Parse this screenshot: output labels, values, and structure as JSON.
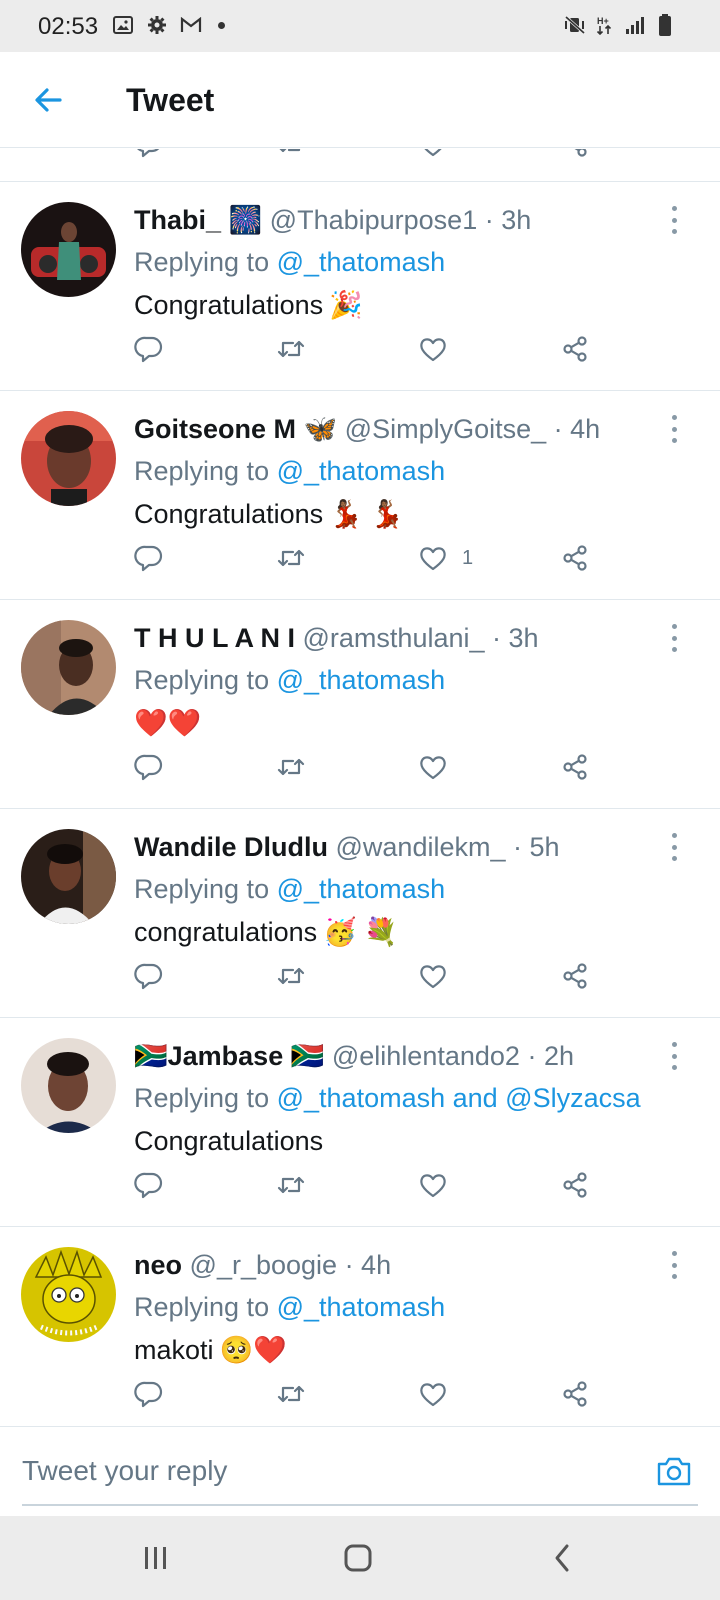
{
  "status_bar": {
    "time": "02:53",
    "left_icons": [
      "gallery-icon",
      "settings-icon",
      "gmail-icon",
      "notification-dot-icon"
    ],
    "right_icons": [
      "vibrate-mute-icon",
      "data-arrows-icon",
      "signal-icon",
      "battery-icon"
    ]
  },
  "header": {
    "title": "Tweet",
    "back_icon": "arrow-left-icon"
  },
  "reply_prefix": "Replying to",
  "replies": [
    {
      "name": "Thabi_",
      "name_emoji": "🎆",
      "handle": "@Thabipurpose1",
      "time": "· 3h",
      "replying_to": "@_thatomash",
      "text": "Congratulations",
      "text_emoji": "🎉",
      "like_count": "",
      "avatar_color": "#5a3a38"
    },
    {
      "name": "Goitseone M",
      "name_emoji": "🦋",
      "handle": "@SimplyGoitse_",
      "time": "· 4h",
      "replying_to": "@_thatomash",
      "text": "Congratulations",
      "text_emoji": "💃🏾 💃🏾",
      "like_count": "1",
      "avatar_color": "#b5473a"
    },
    {
      "name": "T H U L A N I",
      "name_emoji": "",
      "handle": "@ramsthulani_",
      "time": "· 3h",
      "replying_to": "@_thatomash",
      "text": "",
      "text_emoji": "❤️❤️",
      "like_count": "",
      "avatar_color": "#8a6a56"
    },
    {
      "name": "Wandile Dludlu",
      "name_emoji": "",
      "handle": "@wandilekm_",
      "time": "· 5h",
      "replying_to": "@_thatomash",
      "text": "congratulations",
      "text_emoji": "🥳 💐",
      "like_count": "",
      "avatar_color": "#3b2b24"
    },
    {
      "name": "Jambase",
      "name_prefix_emoji": "🇿🇦",
      "name_emoji": "🇿🇦",
      "handle": "@elihlentando2",
      "time": "· 2h",
      "replying_to": "@_thatomash and @Slyzacsa",
      "text": "Congratulations",
      "text_emoji": "",
      "like_count": "",
      "avatar_color": "#d8cfc8"
    },
    {
      "name": "neo",
      "name_emoji": "",
      "handle": "@_r_boogie",
      "time": "· 4h",
      "replying_to": "@_thatomash",
      "text": "makoti",
      "text_emoji": "🥺❤️",
      "like_count": "",
      "avatar_color": "#d6c400"
    }
  ],
  "action_icons": [
    "reply-icon",
    "retweet-icon",
    "like-icon",
    "share-icon"
  ],
  "compose": {
    "placeholder": "Tweet your reply",
    "value": "",
    "camera_icon": "camera-icon"
  },
  "nav_bar": {
    "icons": [
      "recents-icon",
      "home-icon",
      "back-icon"
    ]
  },
  "colors": {
    "accent": "#1b95e0",
    "secondary_text": "#657786",
    "divider": "#e1e8ed"
  }
}
